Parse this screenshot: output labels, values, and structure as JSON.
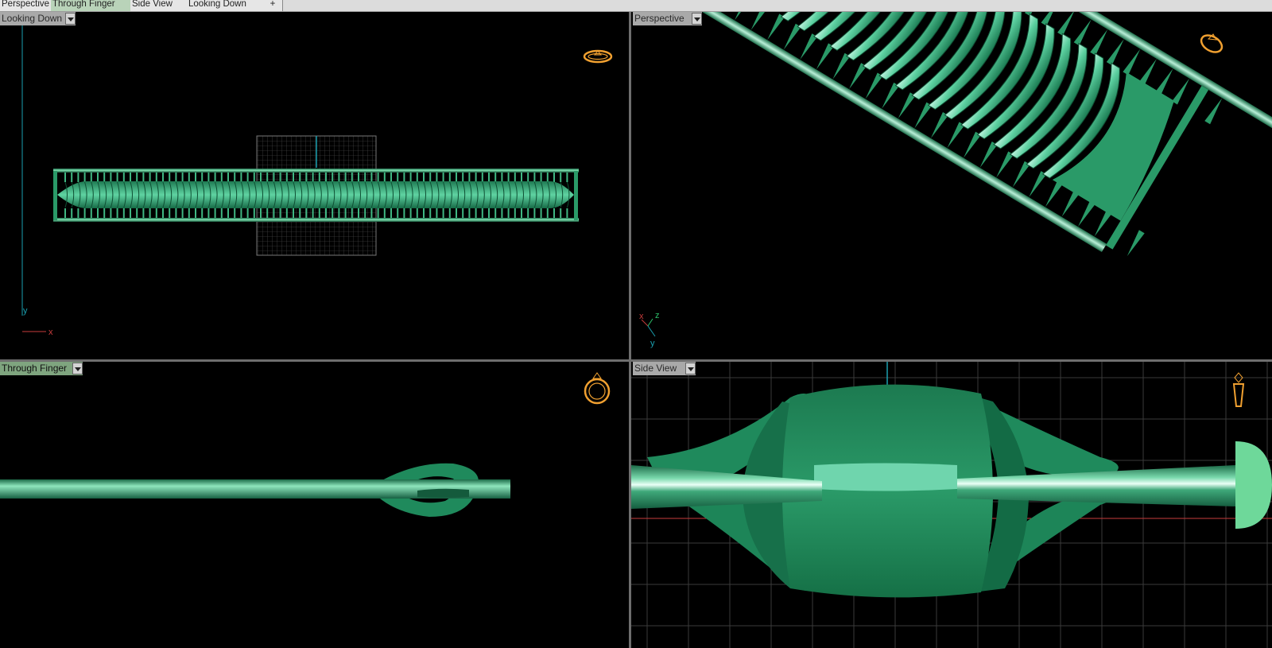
{
  "tabs": [
    {
      "label": "Perspective"
    },
    {
      "label": "Through Finger"
    },
    {
      "label": "Side View"
    },
    {
      "label": "Looking Down"
    },
    {
      "label": "+"
    }
  ],
  "viewports": {
    "top_left": {
      "title": "Looking Down",
      "axis_y": "y",
      "axis_x": "x"
    },
    "top_right": {
      "title": "Perspective",
      "axis_x": "x",
      "axis_z": "z",
      "axis_y": "y"
    },
    "bottom_left": {
      "title": "Through Finger"
    },
    "bottom_right": {
      "title": "Side View"
    }
  },
  "colors": {
    "background": "#000000",
    "model_green": "#2a9a68",
    "model_highlight": "#c8f5e4",
    "grid": "#3c3c3c",
    "axis_red": "#c83c3c",
    "axis_cyan": "#1aa0b0",
    "gumball_orange": "#f0a030"
  },
  "icons": [
    "ring-top-view-icon",
    "ring-perspective-icon",
    "ring-front-view-icon",
    "ring-side-view-icon",
    "dropdown-arrow-icon",
    "add-tab-icon"
  ]
}
